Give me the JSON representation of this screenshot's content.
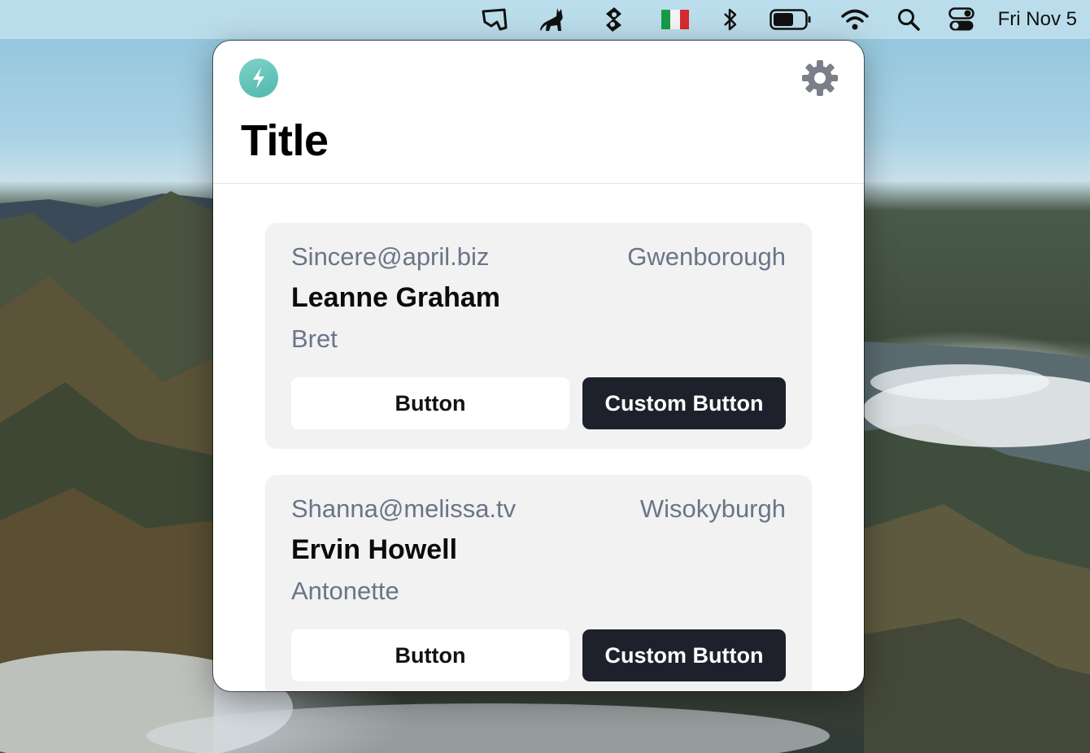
{
  "menubar": {
    "icons": [
      "lasso-app-icon",
      "cat-icon",
      "puzzle-leaf-icon",
      "italy-flag-icon",
      "bluetooth-icon",
      "battery-icon",
      "wifi-icon",
      "search-icon",
      "control-center-icon"
    ],
    "clock": "Fri Nov 5"
  },
  "popover": {
    "title": "Title",
    "app_icon": "bolt-icon",
    "settings_icon": "gear-icon",
    "colors": {
      "accent": "#5cc2b6",
      "dark_button": "#1e212b",
      "card_bg": "#f2f2f3",
      "muted_text": "#6b7587"
    },
    "cards": [
      {
        "email": "Sincere@april.biz",
        "city": "Gwenborough",
        "name": "Leanne Graham",
        "username": "Bret",
        "button_label": "Button",
        "custom_button_label": "Custom Button"
      },
      {
        "email": "Shanna@melissa.tv",
        "city": "Wisokyburgh",
        "name": "Ervin Howell",
        "username": "Antonette",
        "button_label": "Button",
        "custom_button_label": "Custom Button"
      }
    ]
  }
}
